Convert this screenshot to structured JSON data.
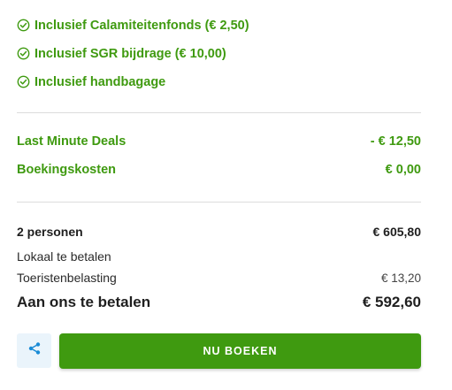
{
  "inclusions": [
    {
      "label": "Inclusief Calamiteitenfonds (€ 2,50)",
      "icon": "check-circle-icon"
    },
    {
      "label": "Inclusief SGR bijdrage (€ 10,00)",
      "icon": "check-circle-icon"
    },
    {
      "label": "Inclusief handbagage",
      "icon": "check-circle-icon"
    }
  ],
  "discounts": [
    {
      "label": "Last Minute Deals",
      "value": "- € 12,50"
    },
    {
      "label": "Boekingskosten",
      "value": "€ 0,00"
    }
  ],
  "summary": {
    "persons_label": "2 personen",
    "persons_value": "€ 605,80",
    "local_label": "Lokaal te betalen",
    "tax_label": "Toeristenbelasting",
    "tax_value": "€ 13,20",
    "total_label": "Aan ons te betalen",
    "total_value": "€ 592,60"
  },
  "actions": {
    "share_icon": "share-icon",
    "book_label": "NU BOEKEN"
  },
  "colors": {
    "accent_green": "#3f9a10",
    "share_bg": "#eaf4fb",
    "share_icon": "#1a8bd6"
  }
}
